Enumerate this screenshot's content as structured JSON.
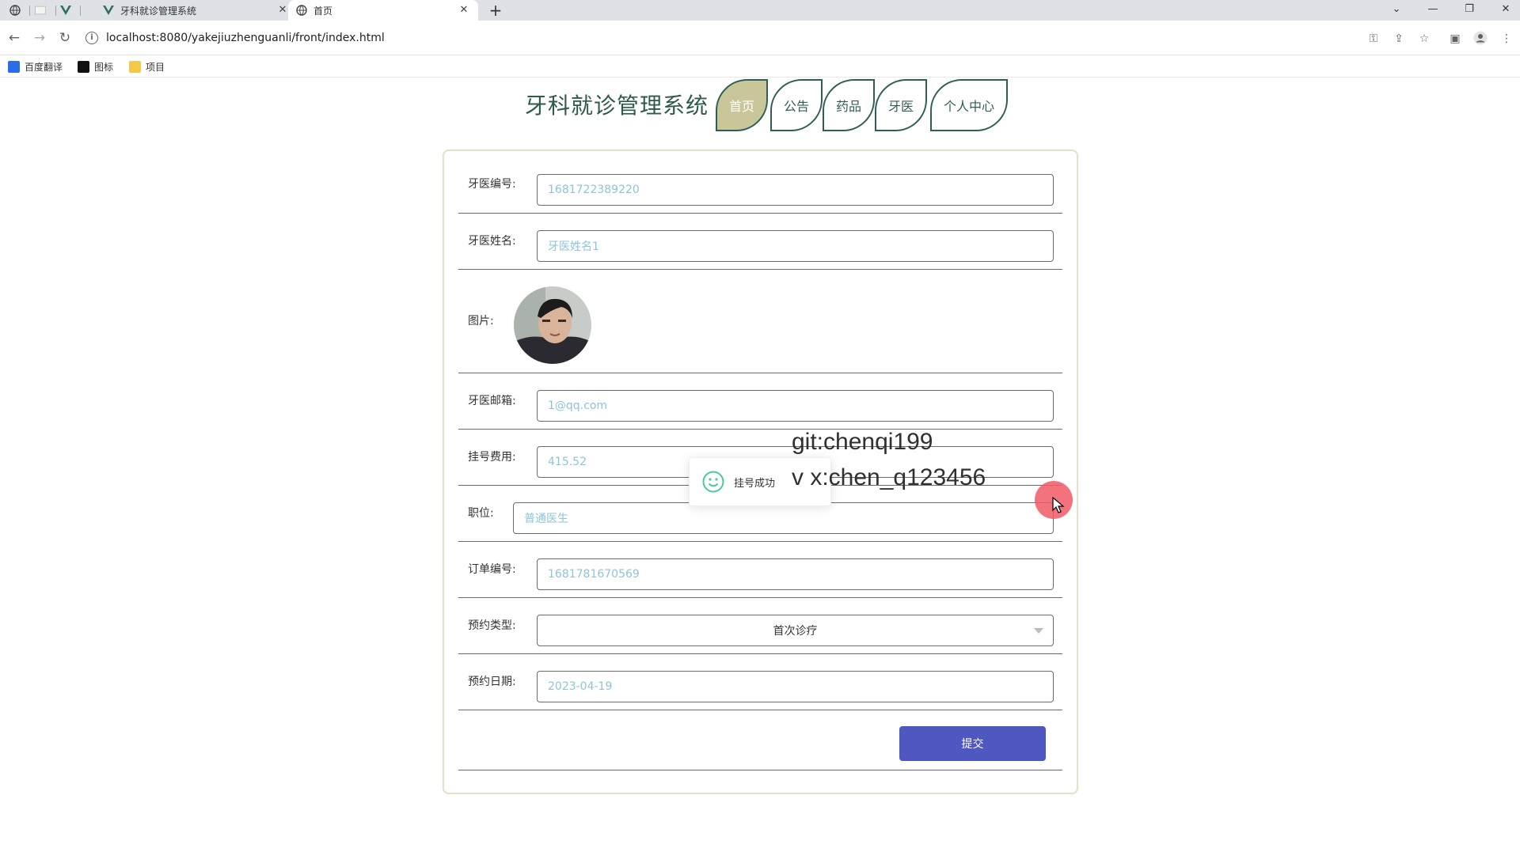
{
  "browser": {
    "tabs": [
      {
        "title": ""
      },
      {
        "title": ""
      },
      {
        "title": ""
      },
      {
        "title": "牙科就诊管理系统"
      },
      {
        "title": "首页"
      }
    ],
    "new_tab": "+",
    "url": "localhost:8080/yakejiuzhenguanli/front/index.html",
    "bookmarks": [
      "百度翻译",
      "图标",
      "项目"
    ]
  },
  "header": {
    "site_title": "牙科就诊管理系统",
    "nav": [
      "首页",
      "公告",
      "药品",
      "牙医",
      "个人中心"
    ],
    "active_nav": "首页"
  },
  "form": {
    "fields": {
      "dentist_id": {
        "label": "牙医编号:",
        "value": "1681722389220"
      },
      "dentist_name": {
        "label": "牙医姓名:",
        "value": "牙医姓名1"
      },
      "image": {
        "label": "图片:"
      },
      "dentist_email": {
        "label": "牙医邮箱:",
        "value": "1@qq.com"
      },
      "fee": {
        "label": "挂号费用:",
        "value": "415.52"
      },
      "position": {
        "label": "职位:",
        "value": "普通医生"
      },
      "order_no": {
        "label": "订单编号:",
        "value": "1681781670569"
      },
      "appt_type": {
        "label": "预约类型:",
        "value": "首次诊疗"
      },
      "appt_date": {
        "label": "预约日期:",
        "value": "2023-04-19"
      }
    },
    "submit_label": "提交"
  },
  "toast": {
    "message": "挂号成功"
  },
  "watermark": {
    "line1": "git:chenqi199",
    "line2": "v x:chen_q123456"
  },
  "colors": {
    "accent": "#4f58c0",
    "nav_border": "#2f5e56",
    "nav_active": "#c9c79a",
    "input_text": "#8ec4d9"
  }
}
